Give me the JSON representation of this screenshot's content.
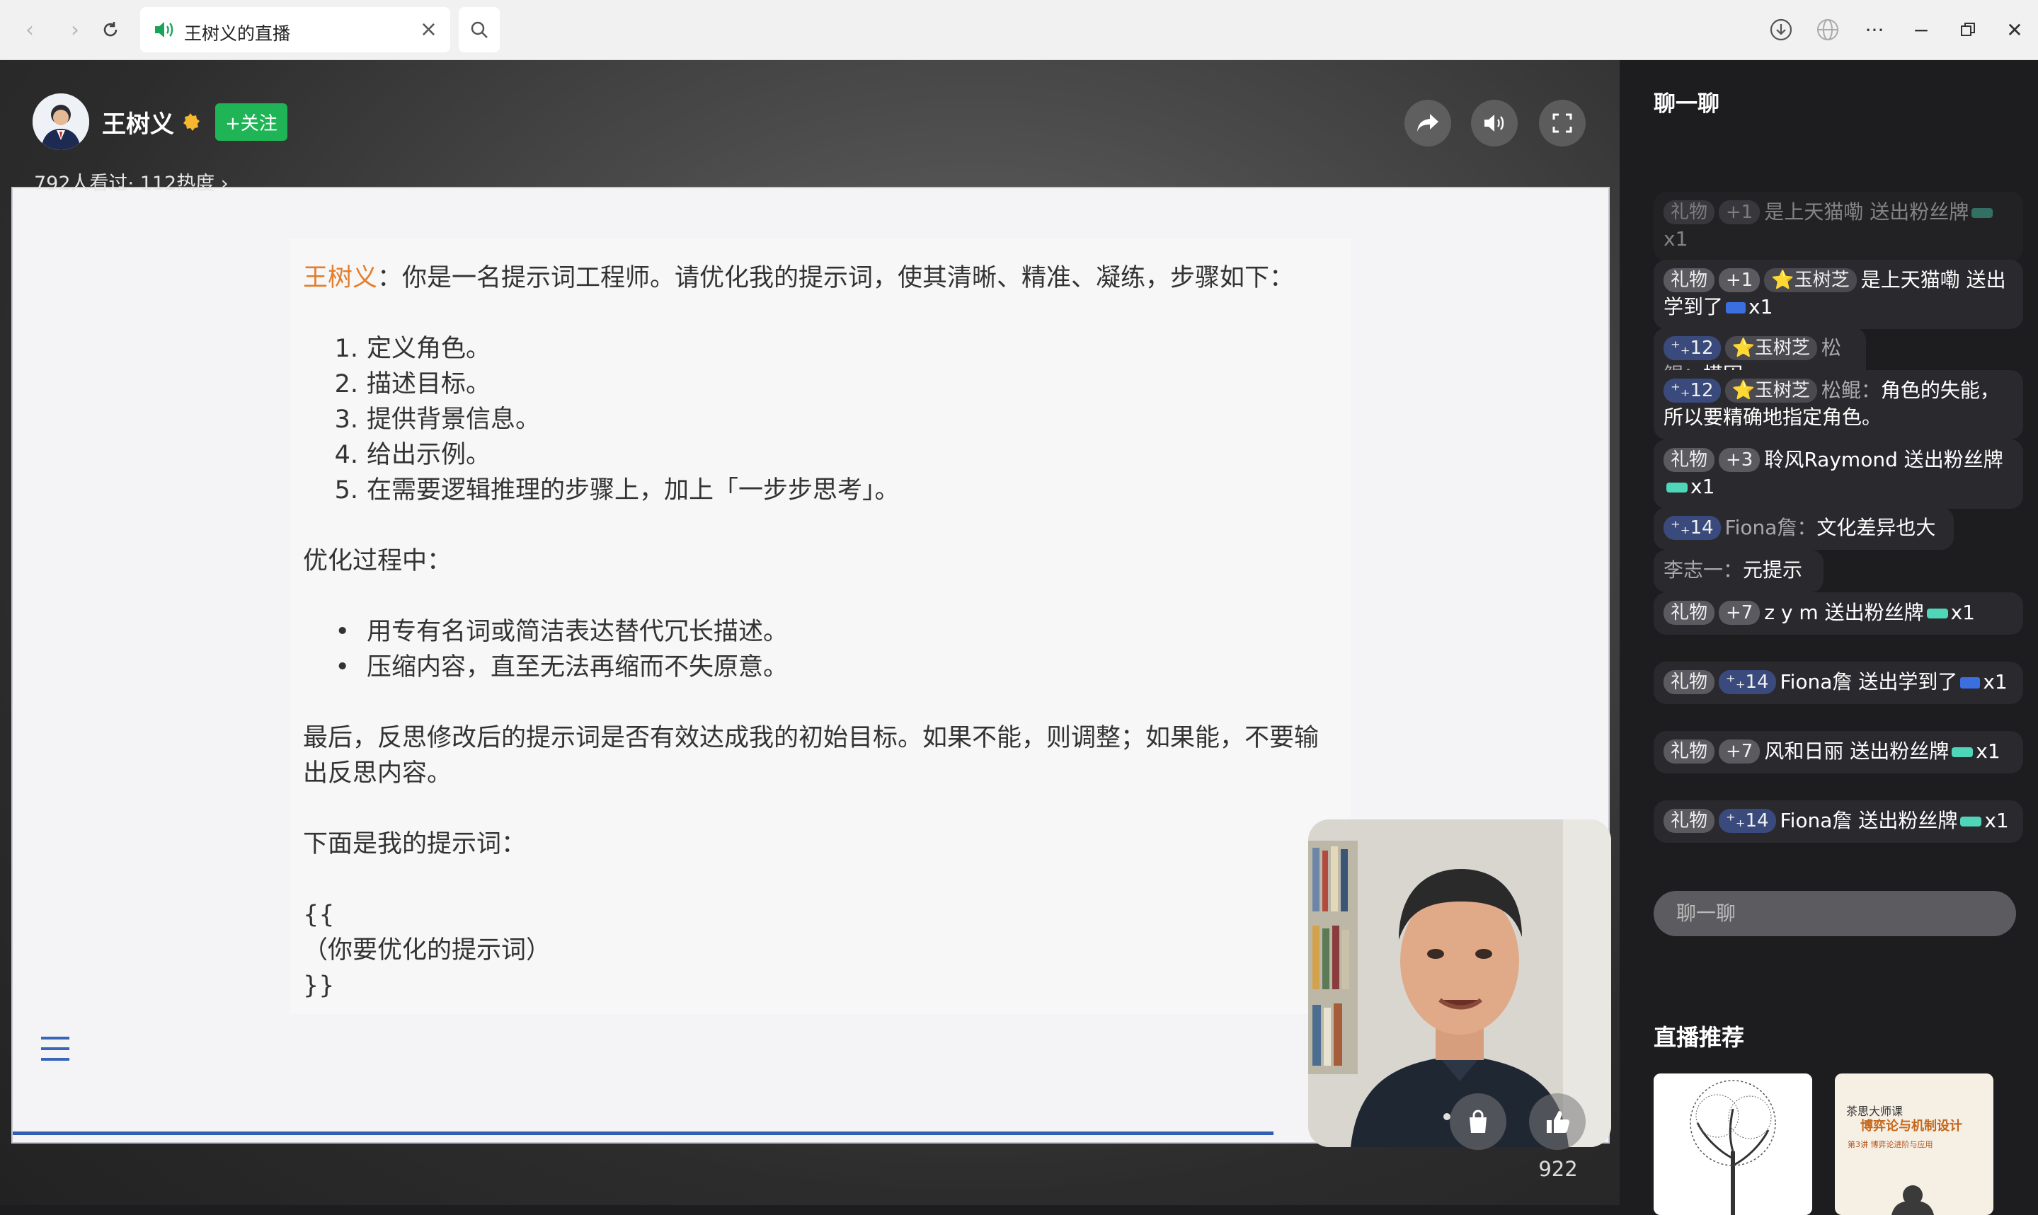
{
  "browser": {
    "tab_title": "王树义的直播"
  },
  "streamer": {
    "name": "王树义",
    "follow_label": "+关注",
    "viewer_stats": "792人看过· 112热度 ›"
  },
  "slide": {
    "author": "王树义",
    "intro": "：你是一名提示词工程师。请优化我的提示词，使其清晰、精准、凝练，步骤如下：",
    "steps": [
      {
        "num": "1.",
        "text": "定义角色。"
      },
      {
        "num": "2.",
        "text": "描述目标。"
      },
      {
        "num": "3.",
        "text": "提供背景信息。"
      },
      {
        "num": "4.",
        "text": "给出示例。"
      },
      {
        "num": "5.",
        "text": "在需要逻辑推理的步骤上，加上「一步步思考」。"
      }
    ],
    "process_heading": "优化过程中：",
    "bullets": [
      "用专有名词或简洁表达替代冗长描述。",
      "压缩内容，直至无法再缩而不失原意。"
    ],
    "reflect": "最后，反思修改后的提示词是否有效达成我的初始目标。如果不能，则调整；如果能，不要输出反思内容。",
    "below": "下面是我的提示词：",
    "open_brace": "{{",
    "placeholder": "（你要优化的提示词）",
    "close_brace": "}}",
    "progress": 0.79
  },
  "like_count": "922",
  "chat": {
    "title": "聊一聊",
    "input_placeholder": "聊一聊",
    "messages": [
      {
        "tag1": "礼物",
        "tag2": "+1",
        "text": "是上天猫嘞 送出粉丝牌",
        "suffix": "x1"
      },
      {
        "tag1": "礼物",
        "tag2": "+1",
        "tag3": "⭐玉树芝",
        "text": "是上天猫嘞 送出学到了",
        "suffix": "x1"
      },
      {
        "tag1": "⁺₊12",
        "tag3": "⭐玉树芝",
        "sender": "松鲲：",
        "text": "模因"
      },
      {
        "tag1": "⁺₊12",
        "tag3": "⭐玉树芝",
        "sender": "松鲲：",
        "text": "角色的失能，所以要精确地指定角色。"
      },
      {
        "tag1": "礼物",
        "tag2": "+3",
        "text": "聆风Raymond 送出粉丝牌",
        "suffix": "x1"
      },
      {
        "tag1": "⁺₊14",
        "sender": "Fiona詹：",
        "text": "文化差异也大"
      },
      {
        "sender": "李志一：",
        "text": "元提示"
      },
      {
        "tag1": "礼物",
        "tag2": "+7",
        "text": "z y m 送出粉丝牌",
        "suffix": "x1"
      },
      {
        "tag1": "礼物",
        "tag2": "⁺₊14",
        "text": "Fiona詹 送出学到了",
        "suffix": "x1"
      },
      {
        "tag1": "礼物",
        "tag2": "+7",
        "text": "风和日丽 送出粉丝牌",
        "suffix": "x1"
      },
      {
        "tag1": "礼物",
        "tag2": "⁺₊14",
        "text": "Fiona詹 送出粉丝牌",
        "suffix": "x1"
      }
    ]
  },
  "recommend": {
    "title": "直播推荐",
    "card2_series": "茶思大师课",
    "card2_title": "博弈论与机制设计",
    "card2_sub": "第3讲 博弈论进阶与应用"
  }
}
